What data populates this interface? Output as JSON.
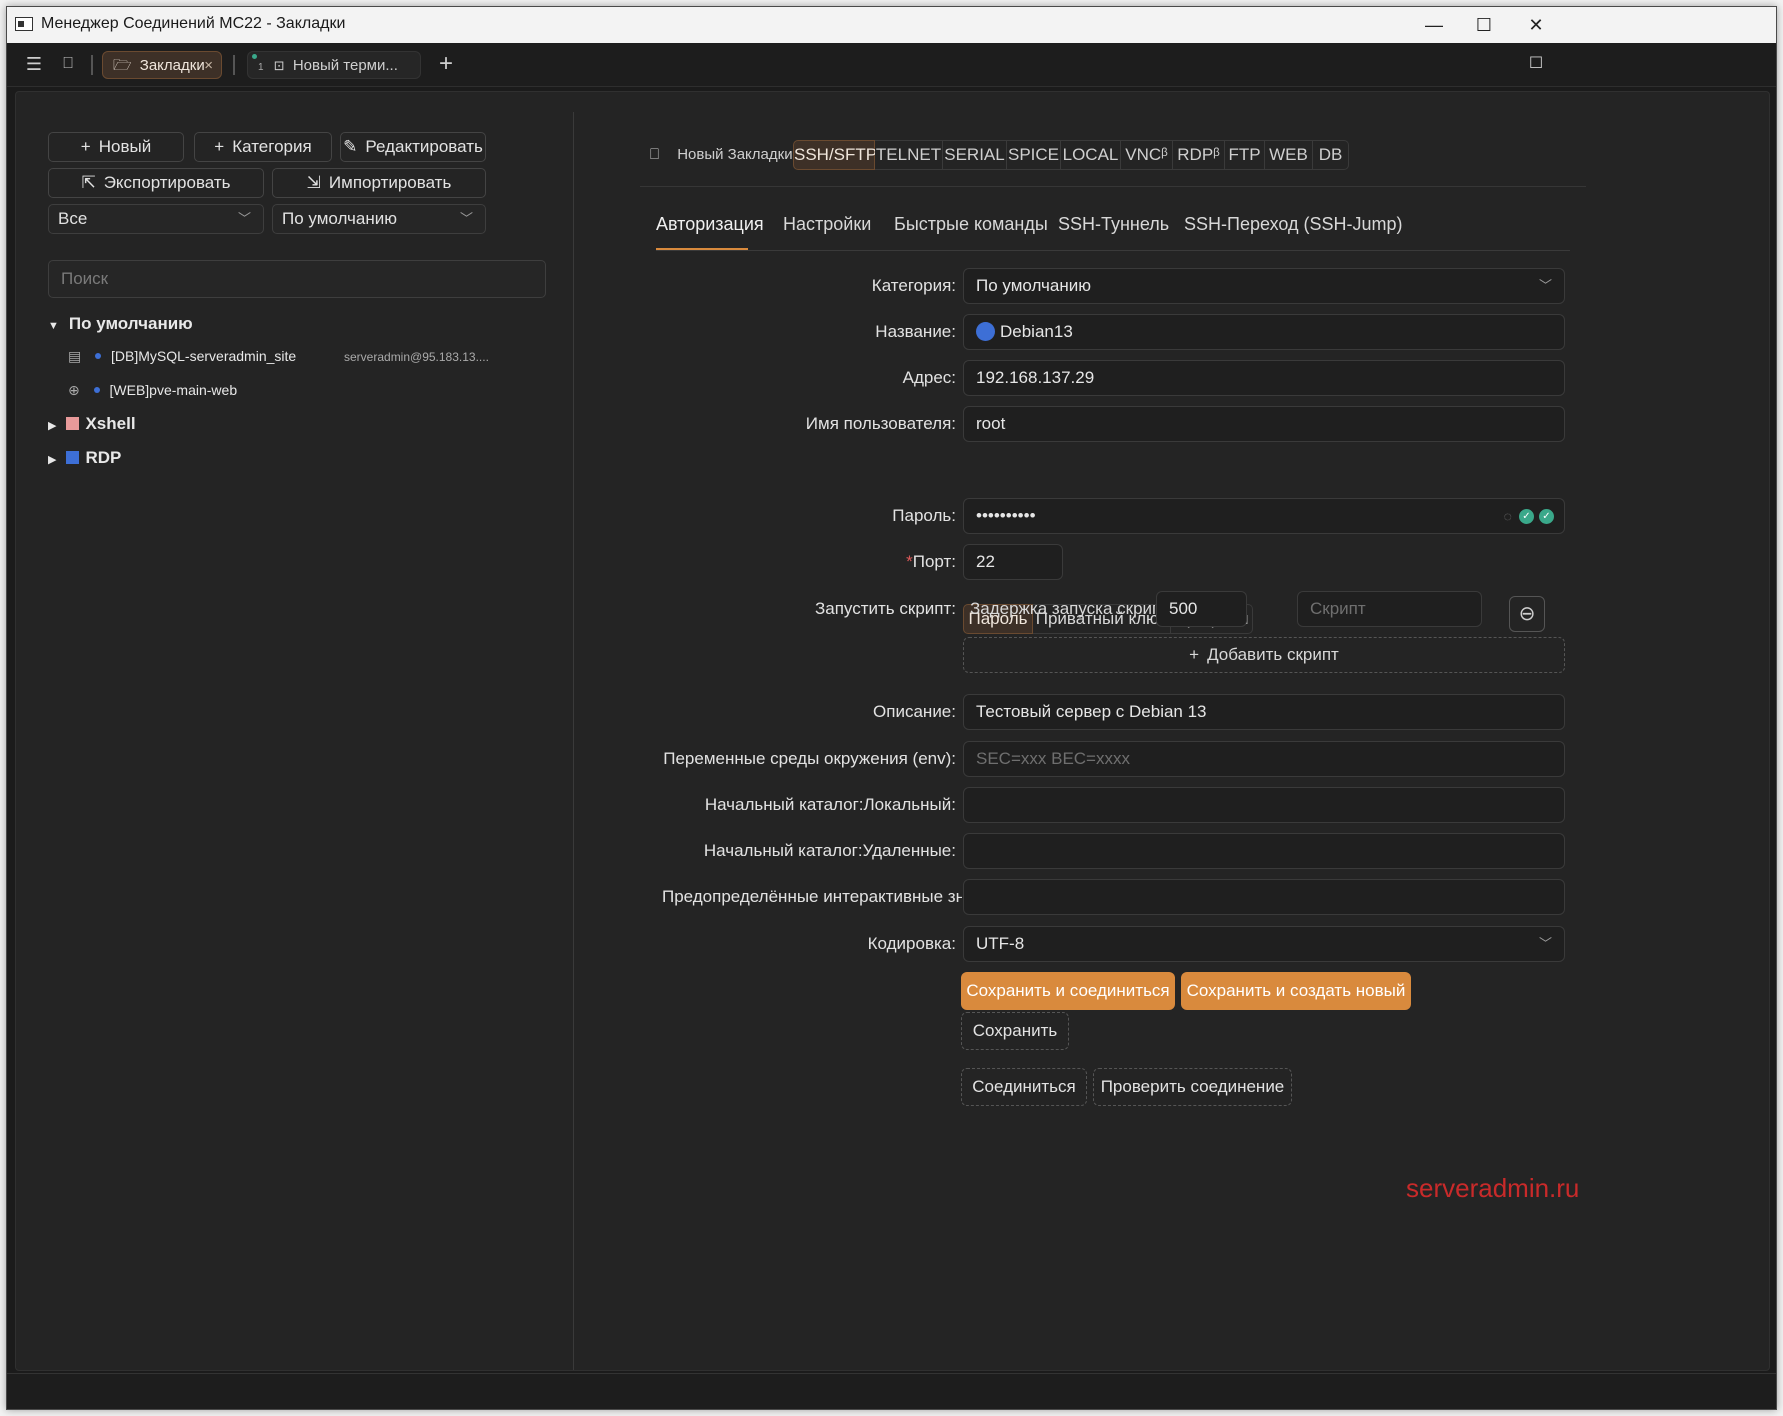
{
  "window": {
    "title": "Менеджер Соединений MC22 - Закладки",
    "minimize": "—",
    "maximize": "☐",
    "close": "✕"
  },
  "tabs": [
    {
      "label": "Закладки",
      "close": "×"
    },
    {
      "badge": "1",
      "label": "Новый терми..."
    }
  ],
  "toolbar": {
    "new_label": "Новый",
    "category_label": "Категория",
    "edit_label": "Редактировать",
    "export_label": "Экспортировать",
    "import_label": "Импортировать"
  },
  "filters": {
    "type_value": "Все",
    "group_value": "По умолчанию"
  },
  "search": {
    "placeholder": "Поиск"
  },
  "tree": {
    "group_default": "По умолчанию",
    "items": [
      {
        "label": "[DB]MySQL-serveradmin_site",
        "meta": "serveradmin@95.183.13...."
      },
      {
        "label": "[WEB]pve-main-web",
        "meta": ""
      }
    ],
    "group_xshell": "Xshell",
    "group_rdp": "RDP",
    "colors": {
      "xshell": "#e89a9a",
      "rdp": "#3d6fd6",
      "dot": "#3d6fd6"
    }
  },
  "protocol": {
    "title": "Новый Закладки",
    "tabs": [
      "SSH/SFTP",
      "TELNET",
      "SERIAL",
      "SPICE",
      "LOCAL",
      "VNCᵝ",
      "RDPᵝ",
      "FTP",
      "WEB",
      "DB"
    ],
    "active": "SSH/SFTP"
  },
  "subtabs": [
    "Авторизация",
    "Настройки",
    "Быстрые команды",
    "SSH-Туннель",
    "SSH-Переход (SSH-Jump)"
  ],
  "form": {
    "category_label": "Категория:",
    "category_value": "По умолчанию",
    "name_label": "Название:",
    "name_value": "Debian13",
    "name_color": "#3d6fd6",
    "address_label": "Адрес:",
    "address_value": "192.168.137.29",
    "user_label": "Имя пользователя:",
    "user_value": "root",
    "auth_modes": [
      "Пароль",
      "Приватный ключ",
      "Профили"
    ],
    "password_label": "Пароль:",
    "password_value": "••••••••••",
    "port_label": "Порт:",
    "port_required": "*",
    "port_value": "22",
    "script_label": "Запустить скрипт:",
    "script_delay_label": "Задержка запуска скрипта",
    "script_delay_value": "500",
    "script_placeholder": "Скрипт",
    "add_script_label": "Добавить скрипт",
    "desc_label": "Описание:",
    "desc_value": "Тестовый сервер с Debian 13",
    "env_label": "Переменные среды окружения (env):",
    "env_placeholder": "SEC=xxx BEC=xxxx",
    "local_dir_label": "Начальный каталог:Локальный:",
    "remote_dir_label": "Начальный каталог:Удаленные:",
    "interactive_label": "Предопределённые интерактивные значения",
    "encoding_label": "Кодировка:",
    "encoding_value": "UTF-8"
  },
  "actions": {
    "save_connect": "Сохранить и соединиться",
    "save_new": "Сохранить и создать новый",
    "save": "Сохранить",
    "connect": "Соединиться",
    "test": "Проверить соединение"
  },
  "watermark": "serveradmin.ru",
  "colors": {
    "accent": "#d98a3d",
    "check": "#3aa88a",
    "watermark": "#c92a2a"
  }
}
